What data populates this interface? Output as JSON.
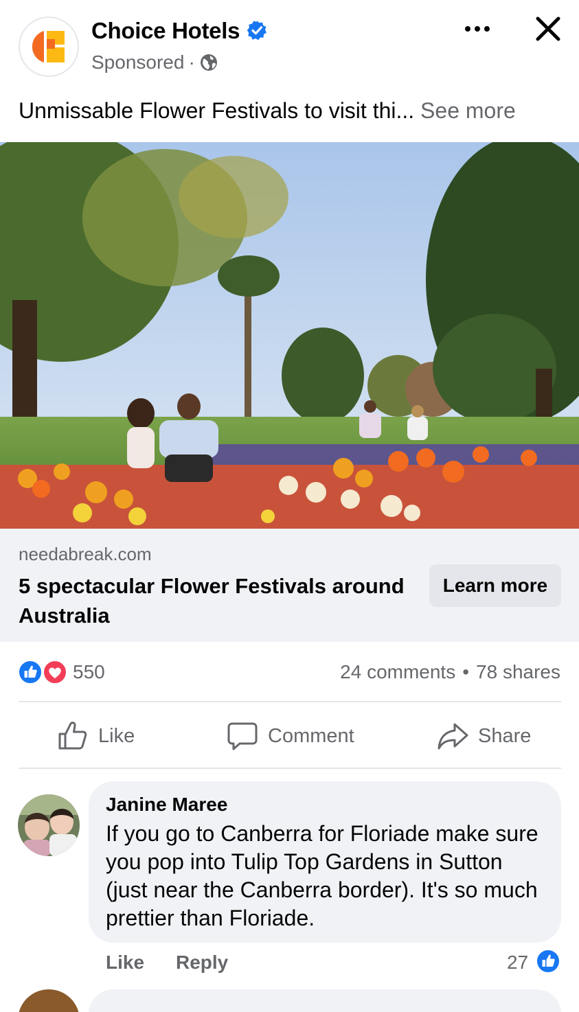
{
  "post": {
    "page_name": "Choice Hotels",
    "sponsored_label": "Sponsored",
    "separator": "·",
    "caption": "Unmissable Flower Festivals to visit thi...",
    "see_more": "See more"
  },
  "link_card": {
    "domain": "needabreak.com",
    "title": "5 spectacular Flower Festivals around Australia",
    "cta_label": "Learn more"
  },
  "engagement": {
    "reaction_count": "550",
    "comments": "24 comments",
    "dot": "•",
    "shares": "78 shares"
  },
  "actions": {
    "like": "Like",
    "comment": "Comment",
    "share": "Share"
  },
  "comment": {
    "author": "Janine Maree",
    "text": "If you go to Canberra for Floriade make sure you pop into Tulip Top Gardens in Sutton (just near the Canberra border). It's so much prettier than Floriade.",
    "like_label": "Like",
    "reply_label": "Reply",
    "like_count": "27"
  },
  "icons": {
    "verified": "verified-badge-icon",
    "globe": "globe-icon",
    "more": "more-options-icon",
    "close": "close-icon",
    "like_reaction": "like-reaction-icon",
    "love_reaction": "love-reaction-icon",
    "thumbs_up": "thumbs-up-icon",
    "speech_bubble": "speech-bubble-icon",
    "share_arrow": "share-arrow-icon"
  },
  "colors": {
    "facebook_blue": "#1877f2",
    "love_red": "#f33e58",
    "secondary_text": "#65676b",
    "card_background": "#f0f2f5",
    "brand_orange": "#f26b21",
    "brand_yellow": "#fdb913"
  }
}
